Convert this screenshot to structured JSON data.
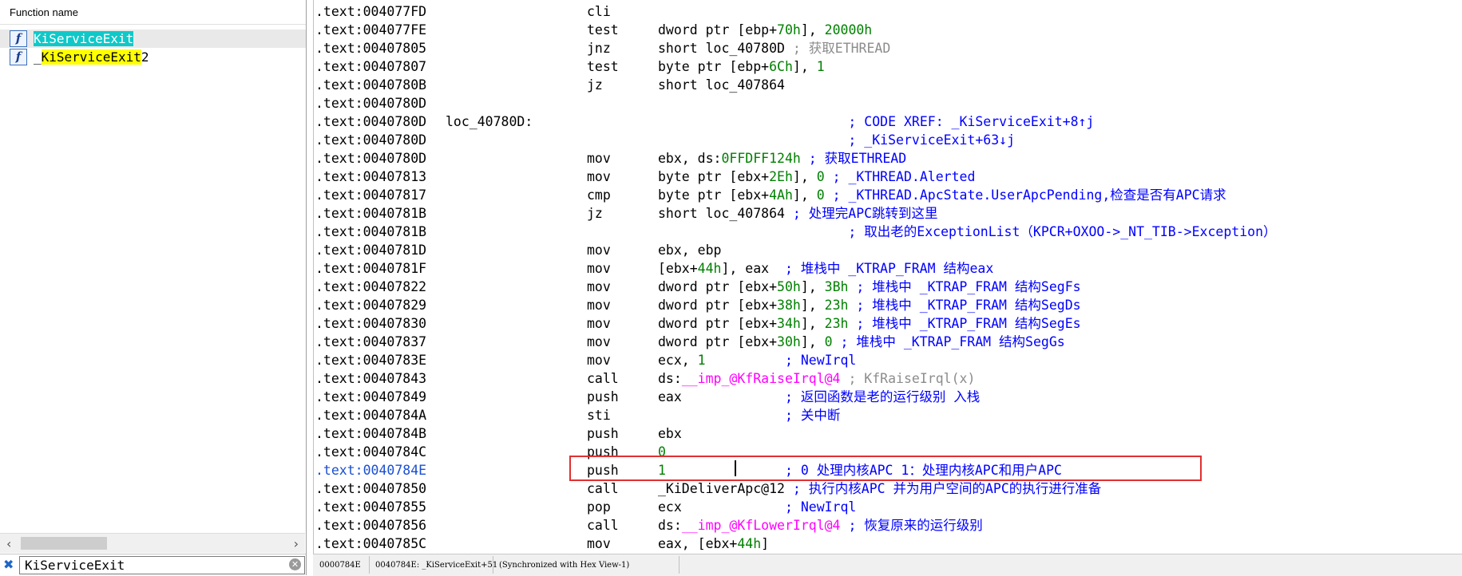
{
  "function_panel": {
    "header": "Function name",
    "items": [
      {
        "prefix": "",
        "match": "KiServiceExit",
        "suffix": "",
        "match_highlight": "cyan",
        "icon": "function-icon"
      },
      {
        "prefix": "_",
        "match": "KiServiceExit",
        "suffix": "2",
        "match_highlight": "yellow",
        "icon": "function-icon"
      }
    ],
    "search_value": "KiServiceExit"
  },
  "disassembly": {
    "highlight_color": "#e03030",
    "rows": [
      {
        "addr": ".text:004077FD",
        "label": "",
        "mnemonic": "cli",
        "parts": []
      },
      {
        "addr": ".text:004077FE",
        "label": "",
        "mnemonic": "test",
        "parts": [
          {
            "t": "dword ptr [ebp+",
            "c": ""
          },
          {
            "t": "70h",
            "c": "num"
          },
          {
            "t": "], ",
            "c": ""
          },
          {
            "t": "20000h",
            "c": "num"
          }
        ]
      },
      {
        "addr": ".text:00407805",
        "label": "",
        "mnemonic": "jnz",
        "parts": [
          {
            "t": "short loc_40780D ",
            "c": ""
          },
          {
            "t": "; 获取ETHREAD",
            "c": "gray"
          }
        ]
      },
      {
        "addr": ".text:00407807",
        "label": "",
        "mnemonic": "test",
        "parts": [
          {
            "t": "byte ptr [ebp+",
            "c": ""
          },
          {
            "t": "6Ch",
            "c": "num"
          },
          {
            "t": "], ",
            "c": ""
          },
          {
            "t": "1",
            "c": "num"
          }
        ]
      },
      {
        "addr": ".text:0040780B",
        "label": "",
        "mnemonic": "jz",
        "parts": [
          {
            "t": "short loc_407864",
            "c": ""
          }
        ]
      },
      {
        "addr": ".text:0040780D",
        "label": "",
        "mnemonic": "",
        "parts": []
      },
      {
        "addr": ".text:0040780D",
        "label": "loc_40780D:",
        "mnemonic": "",
        "parts": [
          {
            "t": "                        ",
            "c": ""
          },
          {
            "t": "; CODE XREF: _KiServiceExit+8↑j",
            "c": "cmt"
          }
        ]
      },
      {
        "addr": ".text:0040780D",
        "label": "",
        "mnemonic": "",
        "parts": [
          {
            "t": "                        ",
            "c": ""
          },
          {
            "t": "; _KiServiceExit+63↓j",
            "c": "cmt"
          }
        ]
      },
      {
        "addr": ".text:0040780D",
        "label": "",
        "mnemonic": "mov",
        "parts": [
          {
            "t": "ebx, ds:",
            "c": ""
          },
          {
            "t": "0FFDFF124h",
            "c": "num"
          },
          {
            "t": " ",
            "c": ""
          },
          {
            "t": "; 获取ETHREAD",
            "c": "cmt"
          }
        ]
      },
      {
        "addr": ".text:00407813",
        "label": "",
        "mnemonic": "mov",
        "parts": [
          {
            "t": "byte ptr [ebx+",
            "c": ""
          },
          {
            "t": "2Eh",
            "c": "num"
          },
          {
            "t": "], ",
            "c": ""
          },
          {
            "t": "0",
            "c": "num"
          },
          {
            "t": " ",
            "c": ""
          },
          {
            "t": "; _KTHREAD.Alerted",
            "c": "cmt"
          }
        ]
      },
      {
        "addr": ".text:00407817",
        "label": "",
        "mnemonic": "cmp",
        "parts": [
          {
            "t": "byte ptr [ebx+",
            "c": ""
          },
          {
            "t": "4Ah",
            "c": "num"
          },
          {
            "t": "], ",
            "c": ""
          },
          {
            "t": "0",
            "c": "num"
          },
          {
            "t": " ",
            "c": ""
          },
          {
            "t": "; _KTHREAD.ApcState.UserApcPending,检查是否有APC请求",
            "c": "cmt"
          }
        ]
      },
      {
        "addr": ".text:0040781B",
        "label": "",
        "mnemonic": "jz",
        "parts": [
          {
            "t": "short loc_407864 ",
            "c": ""
          },
          {
            "t": "; 处理完APC跳转到这里",
            "c": "cmt"
          }
        ]
      },
      {
        "addr": ".text:0040781B",
        "label": "",
        "mnemonic": "",
        "parts": [
          {
            "t": "                        ",
            "c": ""
          },
          {
            "t": "; 取出老的ExceptionList（KPCR+OXOO->_NT_TIB->Exception）",
            "c": "cmt"
          }
        ]
      },
      {
        "addr": ".text:0040781D",
        "label": "",
        "mnemonic": "mov",
        "parts": [
          {
            "t": "ebx, ebp",
            "c": ""
          }
        ]
      },
      {
        "addr": ".text:0040781F",
        "label": "",
        "mnemonic": "mov",
        "parts": [
          {
            "t": "[ebx+",
            "c": ""
          },
          {
            "t": "44h",
            "c": "num"
          },
          {
            "t": "], eax  ",
            "c": ""
          },
          {
            "t": "; 堆栈中 _KTRAP_FRAM 结构eax",
            "c": "cmt"
          }
        ]
      },
      {
        "addr": ".text:00407822",
        "label": "",
        "mnemonic": "mov",
        "parts": [
          {
            "t": "dword ptr [ebx+",
            "c": ""
          },
          {
            "t": "50h",
            "c": "num"
          },
          {
            "t": "], ",
            "c": ""
          },
          {
            "t": "3Bh",
            "c": "num"
          },
          {
            "t": " ",
            "c": ""
          },
          {
            "t": "; 堆栈中 _KTRAP_FRAM 结构SegFs",
            "c": "cmt"
          }
        ]
      },
      {
        "addr": ".text:00407829",
        "label": "",
        "mnemonic": "mov",
        "parts": [
          {
            "t": "dword ptr [ebx+",
            "c": ""
          },
          {
            "t": "38h",
            "c": "num"
          },
          {
            "t": "], ",
            "c": ""
          },
          {
            "t": "23h",
            "c": "num"
          },
          {
            "t": " ",
            "c": ""
          },
          {
            "t": "; 堆栈中 _KTRAP_FRAM 结构SegDs",
            "c": "cmt"
          }
        ]
      },
      {
        "addr": ".text:00407830",
        "label": "",
        "mnemonic": "mov",
        "parts": [
          {
            "t": "dword ptr [ebx+",
            "c": ""
          },
          {
            "t": "34h",
            "c": "num"
          },
          {
            "t": "], ",
            "c": ""
          },
          {
            "t": "23h",
            "c": "num"
          },
          {
            "t": " ",
            "c": ""
          },
          {
            "t": "; 堆栈中 _KTRAP_FRAM 结构SegEs",
            "c": "cmt"
          }
        ]
      },
      {
        "addr": ".text:00407837",
        "label": "",
        "mnemonic": "mov",
        "parts": [
          {
            "t": "dword ptr [ebx+",
            "c": ""
          },
          {
            "t": "30h",
            "c": "num"
          },
          {
            "t": "], ",
            "c": ""
          },
          {
            "t": "0",
            "c": "num"
          },
          {
            "t": " ",
            "c": ""
          },
          {
            "t": "; 堆栈中 _KTRAP_FRAM 结构SegGs",
            "c": "cmt"
          }
        ]
      },
      {
        "addr": ".text:0040783E",
        "label": "",
        "mnemonic": "mov",
        "parts": [
          {
            "t": "ecx, ",
            "c": ""
          },
          {
            "t": "1",
            "c": "num"
          },
          {
            "t": "          ",
            "c": ""
          },
          {
            "t": "; NewIrql",
            "c": "cmt"
          }
        ]
      },
      {
        "addr": ".text:00407843",
        "label": "",
        "mnemonic": "call",
        "parts": [
          {
            "t": "ds:",
            "c": ""
          },
          {
            "t": "__imp_@KfRaiseIrql@4",
            "c": "imp"
          },
          {
            "t": " ",
            "c": ""
          },
          {
            "t": "; KfRaiseIrql(x)",
            "c": "gray"
          }
        ]
      },
      {
        "addr": ".text:00407849",
        "label": "",
        "mnemonic": "push",
        "parts": [
          {
            "t": "eax             ",
            "c": ""
          },
          {
            "t": "; 返回函数是老的运行级别 入栈",
            "c": "cmt"
          }
        ]
      },
      {
        "addr": ".text:0040784A",
        "label": "",
        "mnemonic": "sti",
        "parts": [
          {
            "t": "                ",
            "c": ""
          },
          {
            "t": "; 关中断",
            "c": "cmt"
          }
        ]
      },
      {
        "addr": ".text:0040784B",
        "label": "",
        "mnemonic": "push",
        "parts": [
          {
            "t": "ebx",
            "c": ""
          }
        ]
      },
      {
        "addr": ".text:0040784C",
        "label": "",
        "mnemonic": "push",
        "parts": [
          {
            "t": "0",
            "c": "num"
          }
        ]
      },
      {
        "addr": ".text:0040784E",
        "label": "",
        "mnemonic": "push",
        "current": true,
        "parts": [
          {
            "t": "1",
            "c": "num"
          },
          {
            "t": "               ",
            "c": ""
          },
          {
            "t": "; 0 处理内核APC 1：处理内核APC和用户APC",
            "c": "cmt"
          }
        ]
      },
      {
        "addr": ".text:00407850",
        "label": "",
        "mnemonic": "call",
        "parts": [
          {
            "t": "_KiDeliverApc@12",
            "c": ""
          },
          {
            "t": " ",
            "c": ""
          },
          {
            "t": "; 执行内核APC 并为用户空间的APC的执行进行准备",
            "c": "cmt"
          }
        ]
      },
      {
        "addr": ".text:00407855",
        "label": "",
        "mnemonic": "pop",
        "parts": [
          {
            "t": "ecx             ",
            "c": ""
          },
          {
            "t": "; NewIrql",
            "c": "cmt"
          }
        ]
      },
      {
        "addr": ".text:00407856",
        "label": "",
        "mnemonic": "call",
        "parts": [
          {
            "t": "ds:",
            "c": ""
          },
          {
            "t": "__imp_@KfLowerIrql@4",
            "c": "imp"
          },
          {
            "t": " ",
            "c": ""
          },
          {
            "t": "; 恢复原来的运行级别",
            "c": "cmt"
          }
        ]
      },
      {
        "addr": ".text:0040785C",
        "label": "",
        "mnemonic": "mov",
        "parts": [
          {
            "t": "eax, [ebx+",
            "c": ""
          },
          {
            "t": "44h",
            "c": "num"
          },
          {
            "t": "]",
            "c": ""
          }
        ]
      }
    ]
  },
  "status_bar": {
    "offset": "0000784E",
    "location": "0040784E: _KiServiceExit+51",
    "sync": "(Synchronized with Hex View-1)"
  }
}
